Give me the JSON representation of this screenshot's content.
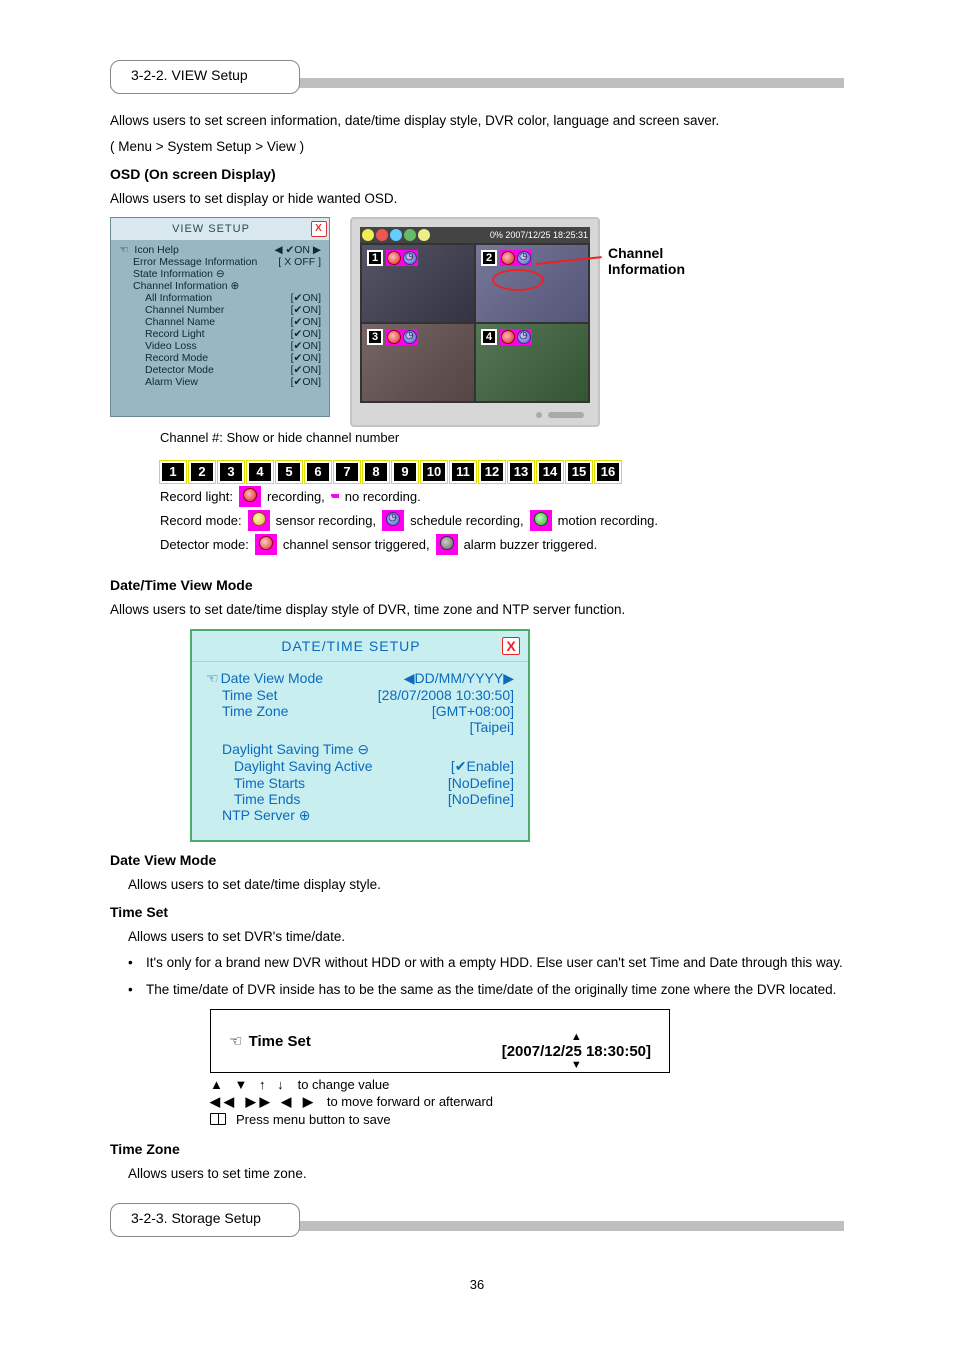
{
  "section1": {
    "heading": "3-2-2. VIEW Setup"
  },
  "body1": [
    "Allows users to set screen information, date/time display style, DVR color, language and screen saver.",
    "( Menu > System Setup > View )",
    "OSD (On screen Display)",
    "Allows users to set display or hide wanted OSD."
  ],
  "viewDlg": {
    "title": "VIEW   SETUP",
    "rows": {
      "iconHelp": {
        "label": "Icon Help",
        "value": "◀ ✔ON ▶"
      },
      "errMsg": {
        "label": "Error Message Information",
        "value": "[ X OFF ]"
      },
      "state": {
        "label": "State Information ⊖",
        "value": ""
      },
      "chInfo": {
        "label": "Channel Information ⊕",
        "value": ""
      },
      "allInfo": {
        "label": "All Information",
        "value": "[✔ON]"
      },
      "chNum": {
        "label": "Channel Number",
        "value": "[✔ON]"
      },
      "chName": {
        "label": "Channel Name",
        "value": "[✔ON]"
      },
      "recLight": {
        "label": "Record Light",
        "value": "[✔ON]"
      },
      "vLoss": {
        "label": "Video Loss",
        "value": "[✔ON]"
      },
      "recMode": {
        "label": "Record Mode",
        "value": "[✔ON]"
      },
      "detMode": {
        "label": "Detector Mode",
        "value": "[✔ON]"
      },
      "alarm": {
        "label": "Alarm View",
        "value": "[✔ON]"
      }
    }
  },
  "monitor": {
    "status": "0%  2007/12/25  18:25:31",
    "callout1": "Channel",
    "callout2": "Information"
  },
  "chStrip": [
    "1",
    "2",
    "3",
    "4",
    "5",
    "6",
    "7",
    "8",
    "9",
    "10",
    "11",
    "12",
    "13",
    "14",
    "15",
    "16"
  ],
  "legend": {
    "chNum": "Channel #: Show or hide channel number",
    "recLight1": "Record light: ",
    "recLight2": "recording,    ",
    "recLight3": "no recording.",
    "recMode1": "Record mode: ",
    "recMode2": "sensor recording, ",
    "recMode3": "schedule recording, ",
    "recMode4": "motion recording.",
    "dMode1": "Detector mode: ",
    "dMode2": "channel sensor triggered, ",
    "dMode3": "alarm buzzer triggered."
  },
  "dateHdr": "Date/Time View Mode",
  "dateTxt": "Allows users to set date/time display style of DVR, time zone and NTP server function.",
  "dtDlg": {
    "title": "DATE/TIME  SETUP",
    "r1": {
      "label": "Date View Mode",
      "value": "◀DD/MM/YYYY▶"
    },
    "r2": {
      "label": "Time Set",
      "value": "[28/07/2008 10:30:50]"
    },
    "r3": {
      "label": "Time Zone",
      "value": "[GMT+08:00]"
    },
    "r3b": {
      "value": "[Taipei]"
    },
    "r4": {
      "label": "Daylight Saving Time ⊖"
    },
    "r5": {
      "label": "Daylight Saving Active",
      "value": "[✔Enable]"
    },
    "r6": {
      "label": "Time Starts",
      "value": "[NoDefine]"
    },
    "r7": {
      "label": "Time Ends",
      "value": "[NoDefine]"
    },
    "r8": {
      "label": "NTP Server ⊕"
    }
  },
  "dvmHdr": "Date View Mode",
  "dvmTxt": "Allows users to set date/time display style.",
  "tsHdr": "Time Set",
  "tsTxt": "Allows users to set DVR's time/date.",
  "tsBullets": [
    "It's only for a brand new DVR without HDD or with a empty HDD. Else user can't set Time and Date through this way.",
    "The time/date of DVR inside has to be the same as the time/date of the originally time zone where the DVR located."
  ],
  "tsBox": {
    "label": "Time Set",
    "value": "[2007/12/25 18:30:50]"
  },
  "keys": {
    "k1s": "▲  ▼  ↑  ↓",
    "k1t": "to change value",
    "k2s": "◀◀  ▶▶  ◀  ▶",
    "k2t": "to move forward or afterward",
    "k3t": "Press menu button to save"
  },
  "tzHdr": "Time Zone",
  "tzTxt": "Allows users to set time zone.",
  "section2": {
    "heading": "3-2-3. Storage Setup"
  },
  "foot": "36"
}
